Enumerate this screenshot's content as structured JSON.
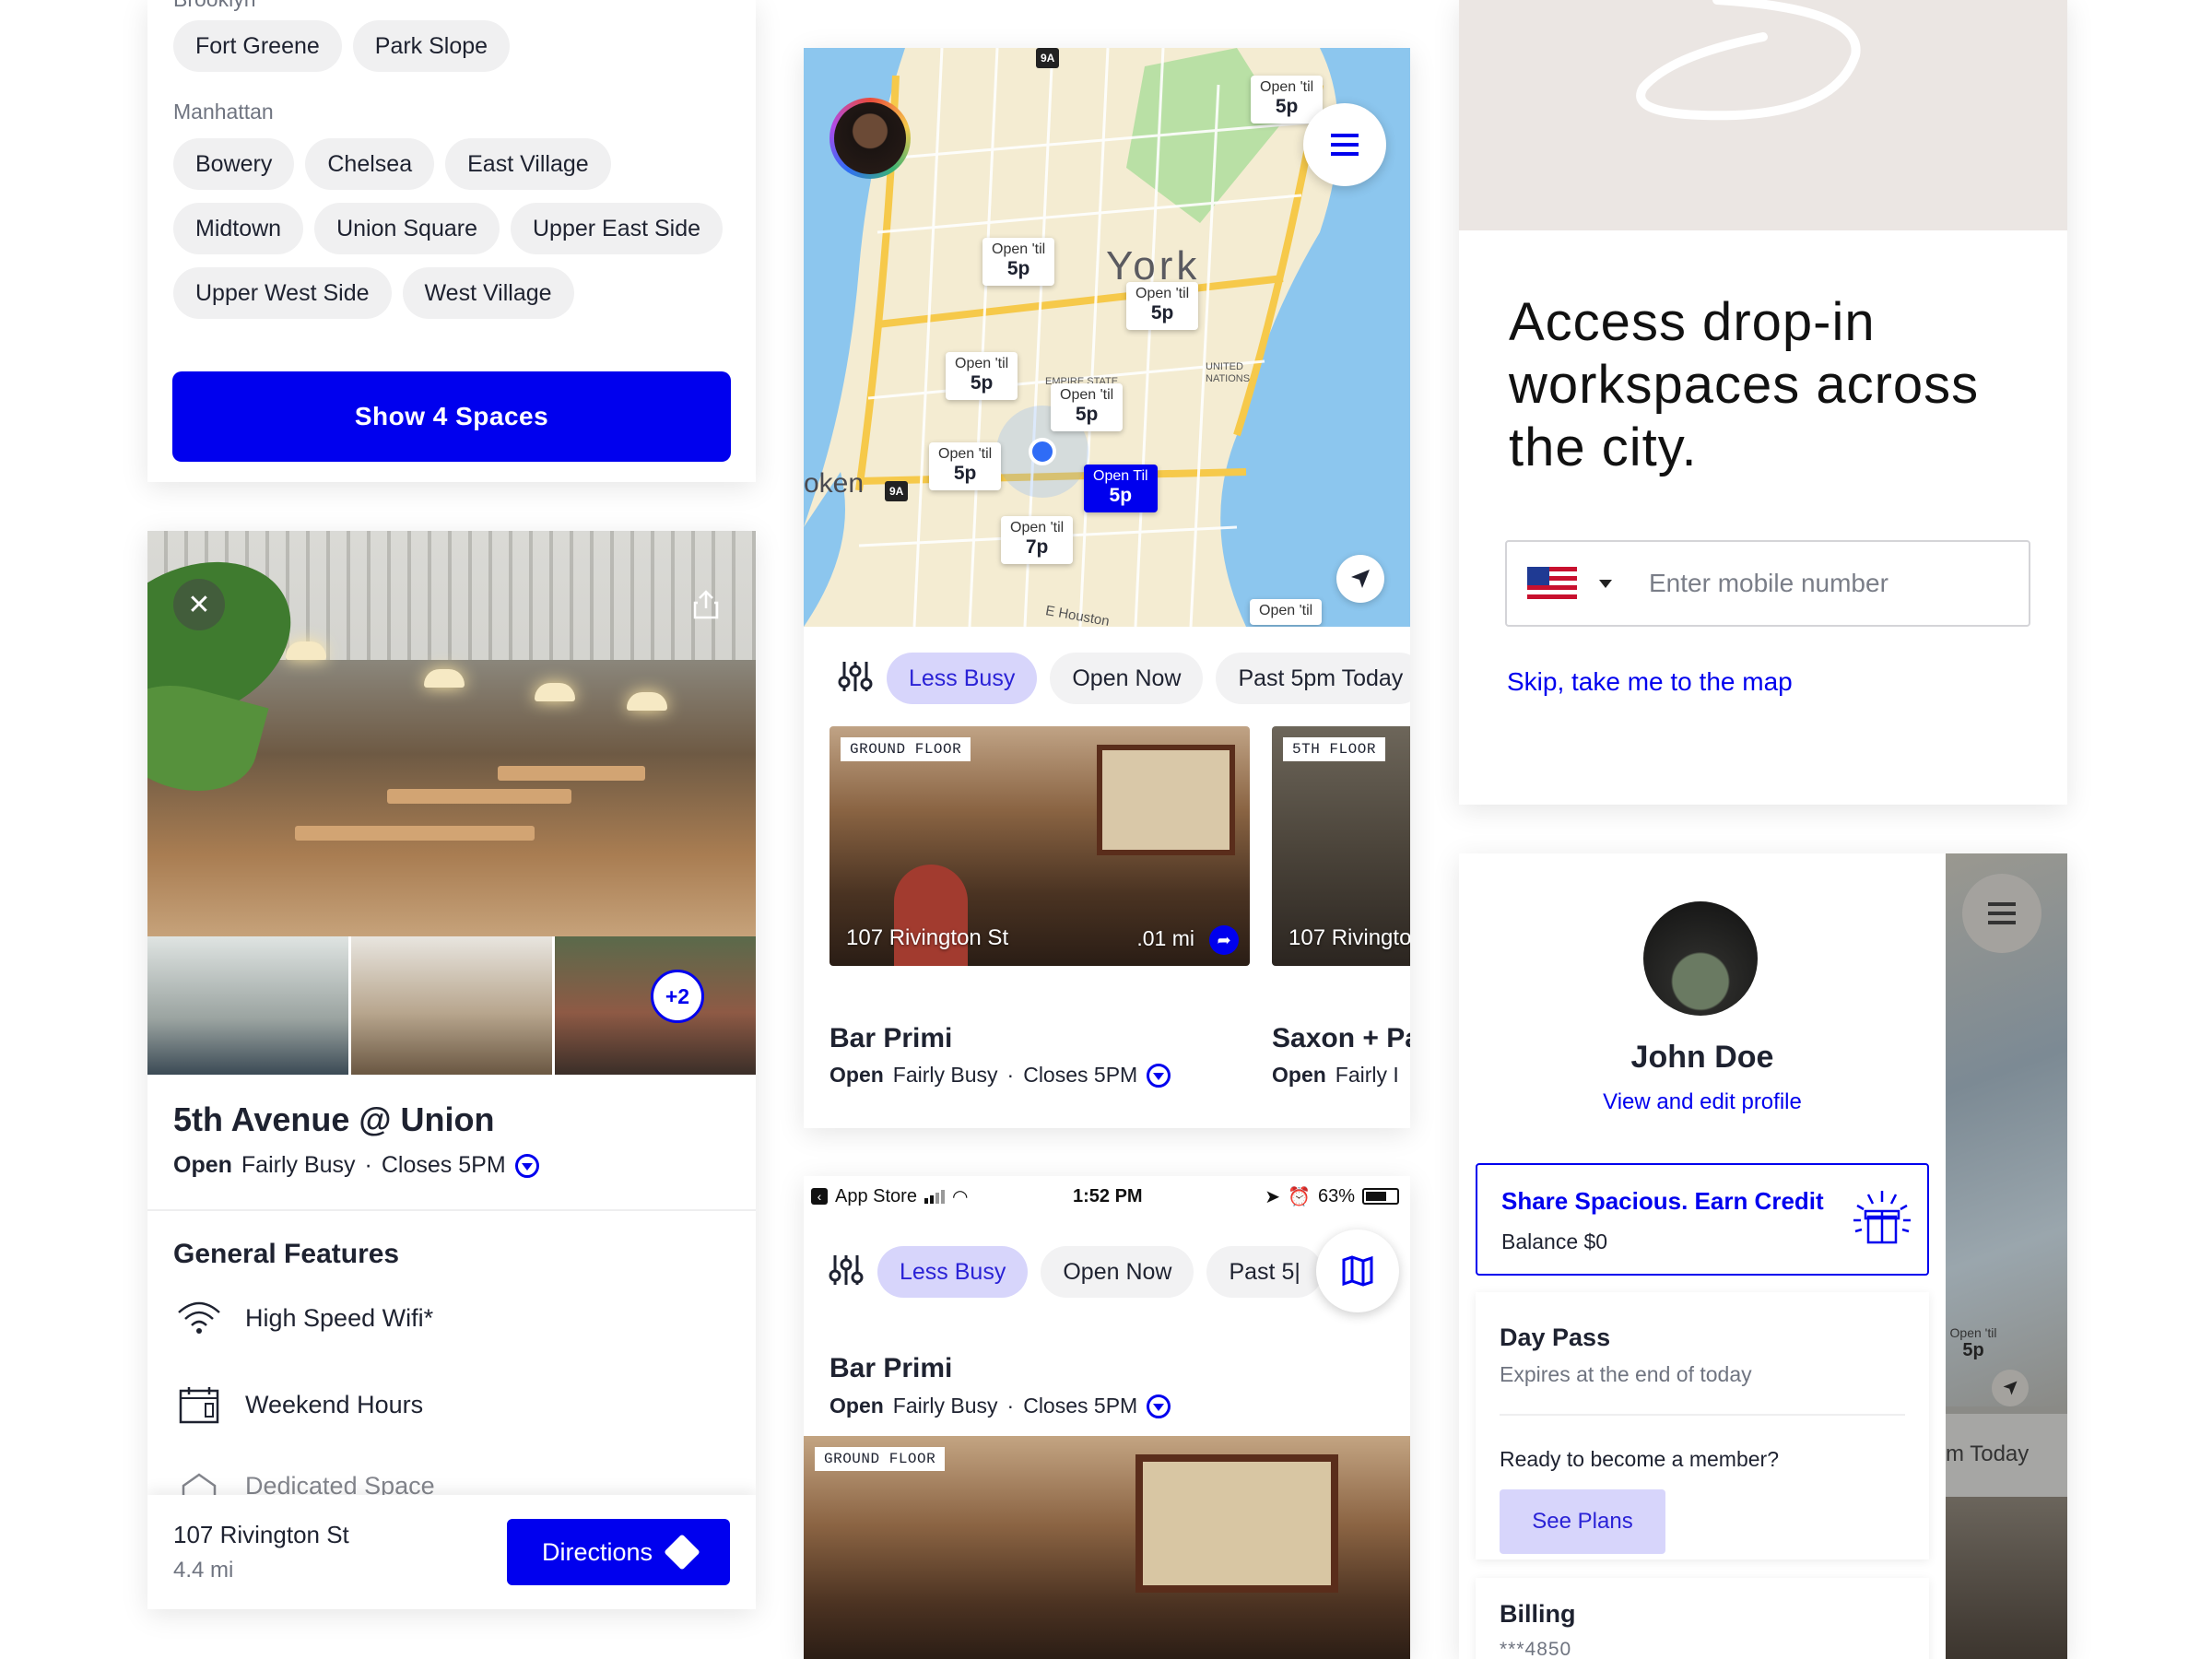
{
  "filter_panel": {
    "region_top": "Brooklyn",
    "brooklyn_chips": [
      "Fort Greene",
      "Park Slope"
    ],
    "region_manhattan": "Manhattan",
    "manhattan_rows": [
      [
        "Bowery",
        "Chelsea",
        "East Village"
      ],
      [
        "Midtown",
        "Union Square",
        "Upper East Side"
      ],
      [
        "Upper West Side",
        "West Village"
      ]
    ],
    "show_button": "Show 4 Spaces"
  },
  "detail": {
    "extra_photos_badge": "+2",
    "title": "5th Avenue @ Union",
    "open": "Open",
    "busy": "Fairly Busy",
    "sep": "·",
    "closes": "Closes 5PM",
    "features_title": "General Features",
    "features": [
      {
        "label": "High Speed Wifi*",
        "icon": "wifi-icon"
      },
      {
        "label": "Weekend Hours",
        "icon": "calendar-icon"
      },
      {
        "label": "Dedicated Space",
        "icon": "desk-icon"
      }
    ],
    "address": "107 Rivington St",
    "distance": "4.4 mi",
    "directions_label": "Directions"
  },
  "map": {
    "label_york": "York",
    "label_hoboken": "oken",
    "label_empire": "EMPIRE STATE",
    "label_un": "UNITED NATIONS",
    "label_houston": "E Houston",
    "route_9a": "9A",
    "pins": [
      {
        "small": "Open 'til",
        "big": "5p"
      },
      {
        "small": "Open 'til",
        "big": "5p"
      },
      {
        "small": "Open 'til",
        "big": "5p"
      },
      {
        "small": "Open 'til",
        "big": "5p"
      },
      {
        "small": "Open 'til",
        "big": "5p"
      },
      {
        "small": "Open 'til",
        "big": "5p"
      },
      {
        "small": "Open 'til",
        "big": "7p"
      },
      {
        "small": "Open 'til",
        "big": ""
      }
    ],
    "active_pin": {
      "small": "Open Til",
      "big": "5p"
    }
  },
  "list_filters": {
    "chips": [
      "Less Busy",
      "Open Now",
      "Past 5pm Today"
    ]
  },
  "listings": [
    {
      "floor": "GROUND FLOOR",
      "address": "107 Rivington St",
      "distance": ".01 mi",
      "name": "Bar Primi",
      "open": "Open",
      "busy": "Fairly Busy",
      "closes": "Closes 5PM"
    },
    {
      "floor": "5TH FLOOR",
      "address": "107 Rivingto",
      "name": "Saxon + Pa",
      "open": "Open",
      "busy": "Fairly I"
    }
  ],
  "phone": {
    "back_app": "App Store",
    "time": "1:52 PM",
    "battery": "63%",
    "chips": [
      "Less Busy",
      "Open Now",
      "Past 5|"
    ],
    "listing_name": "Bar Primi",
    "open": "Open",
    "busy": "Fairly Busy",
    "closes": "Closes 5PM",
    "floor": "GROUND FLOOR"
  },
  "login": {
    "headline": "Access drop-in workspaces across the city.",
    "phone_placeholder": "Enter mobile number",
    "skip_link": "Skip, take me to the map"
  },
  "profile": {
    "name": "John Doe",
    "edit_link": "View and edit profile",
    "credit_title": "Share Spacious. Earn Credit",
    "balance": "Balance $0",
    "pass_title": "Day Pass",
    "pass_sub": "Expires at the end of today",
    "member_q": "Ready to become a member?",
    "plans_button": "See Plans",
    "billing_title": "Billing",
    "billing_card": "***4850",
    "side_pin_small": "Open 'til",
    "side_pin_big": "5p",
    "side_chip": "m Today"
  },
  "colors": {
    "accent": "#0000ee",
    "chip_selected_bg": "#d7d5fb",
    "chip_bg": "#f0f0f1",
    "text": "#1e2230",
    "muted": "#6f7480"
  }
}
